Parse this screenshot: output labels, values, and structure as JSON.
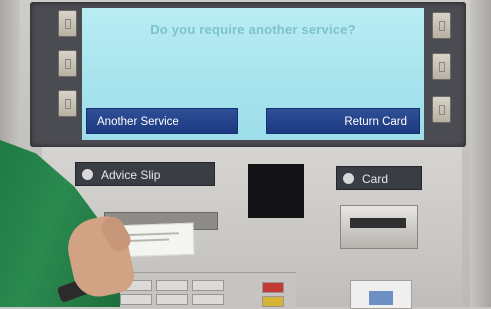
{
  "screen": {
    "prompt": "Do you require another service?",
    "left_button_label": "Another Service",
    "right_button_label": "Return Card"
  },
  "fascia": {
    "advice_slip_label": "Advice Slip",
    "card_label": "Card"
  },
  "colors": {
    "screen_background": "#a8e4ee",
    "screen_button": "#1f3d86",
    "sleeve": "#23804a"
  }
}
